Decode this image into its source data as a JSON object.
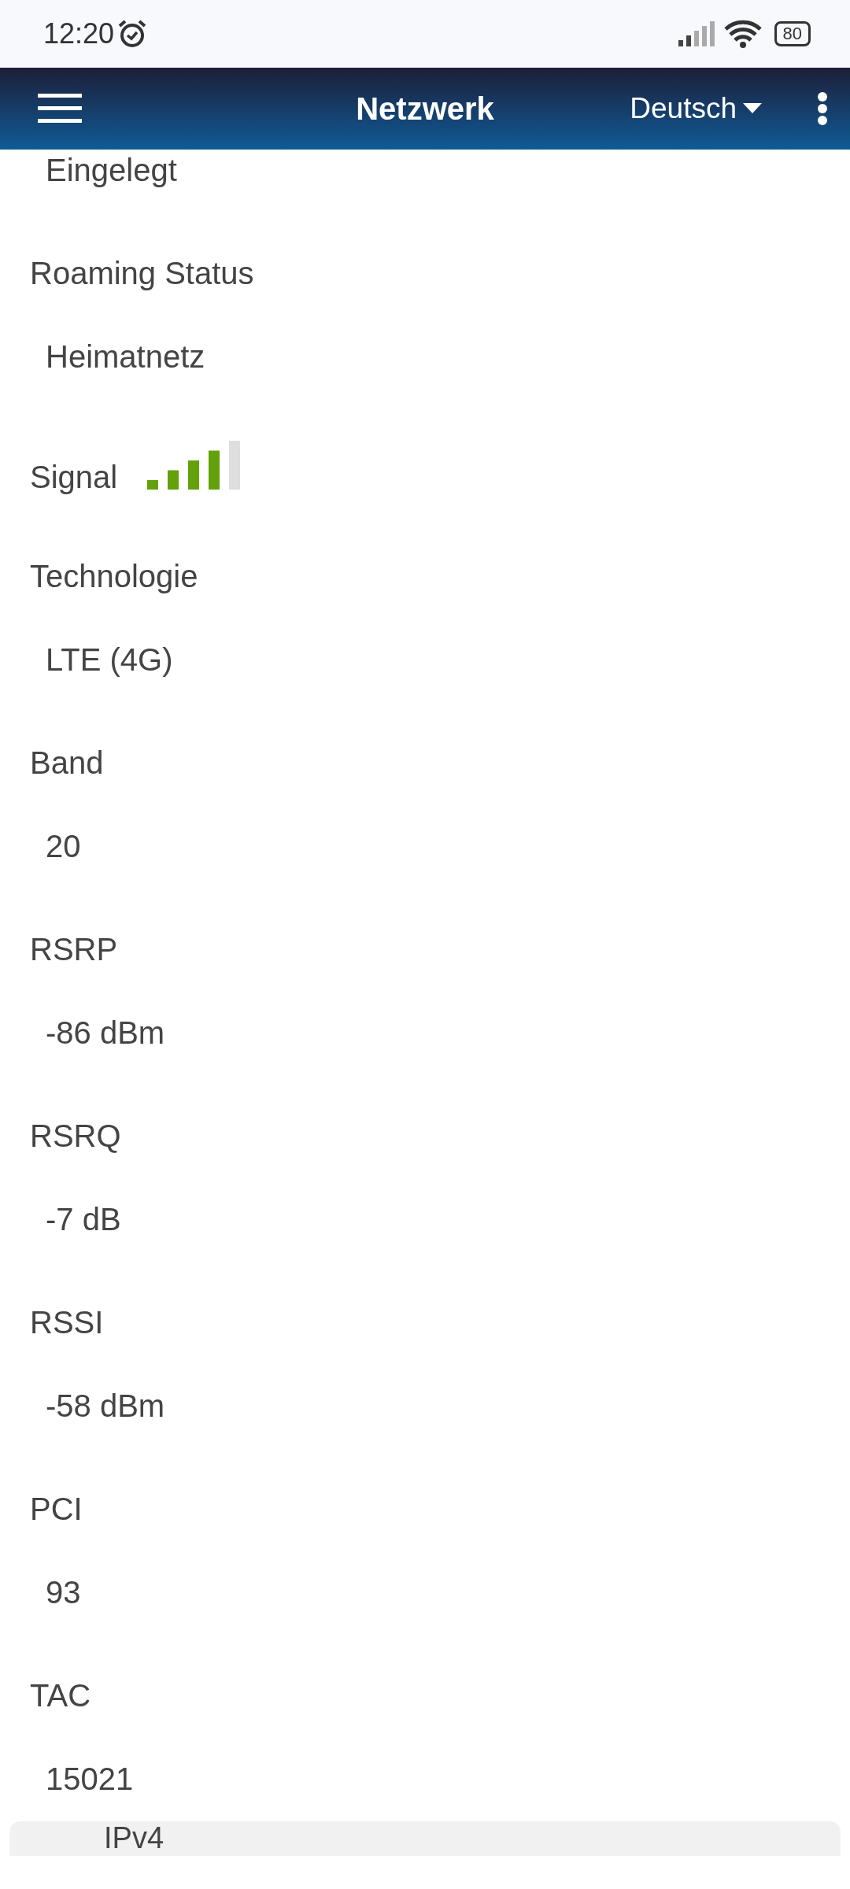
{
  "status_bar": {
    "time": "12:20",
    "battery": "80"
  },
  "header": {
    "title": "Netzwerk",
    "language": "Deutsch"
  },
  "fields": [
    {
      "kind": "value",
      "value": "Eingelegt"
    },
    {
      "kind": "text",
      "label": "Roaming Status",
      "value": "Heimatnetz"
    },
    {
      "kind": "signal",
      "label": "Signal",
      "level": 0.8
    },
    {
      "kind": "text",
      "label": "Technologie",
      "value": "LTE (4G)"
    },
    {
      "kind": "text",
      "label": "Band",
      "value": "20"
    },
    {
      "kind": "text",
      "label": "RSRP",
      "value": "-86 dBm"
    },
    {
      "kind": "text",
      "label": "RSRQ",
      "value": "-7 dB"
    },
    {
      "kind": "text",
      "label": "RSSI",
      "value": "-58 dBm"
    },
    {
      "kind": "text",
      "label": "PCI",
      "value": "93"
    },
    {
      "kind": "text",
      "label": "TAC",
      "value": "15021"
    }
  ],
  "next_section": {
    "title": "IPv4"
  }
}
